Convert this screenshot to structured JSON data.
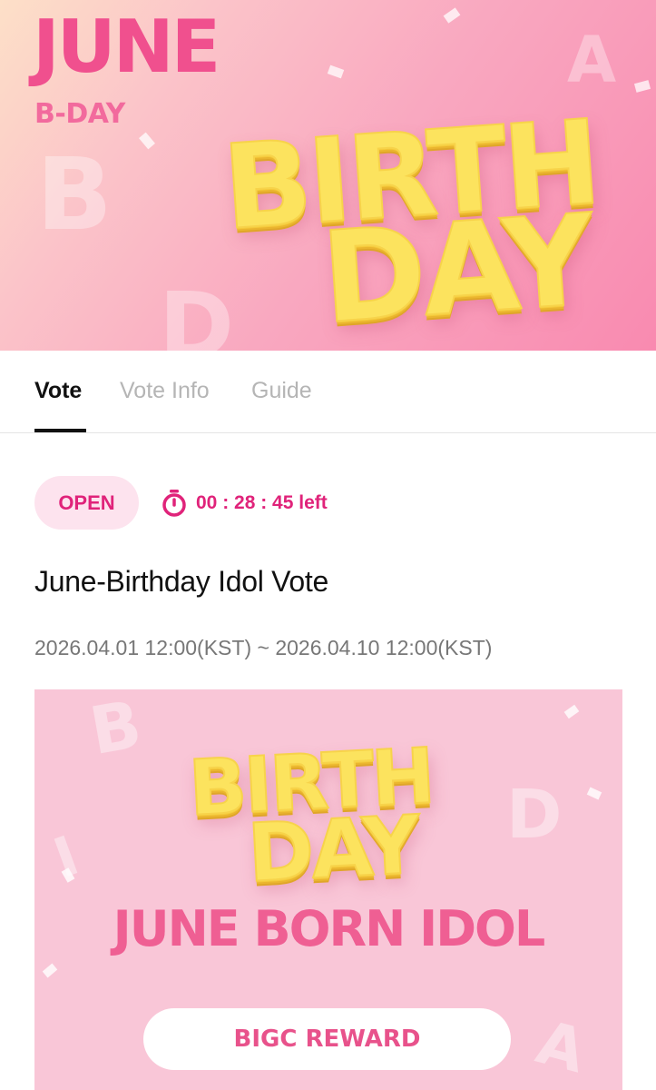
{
  "hero": {
    "month": "JUNE",
    "subtitle": "B-DAY",
    "word_line1": "BIRTH",
    "word_line2": "DAY",
    "ghost_letters": [
      "B",
      "D",
      "A"
    ]
  },
  "tabs": [
    {
      "label": "Vote",
      "active": true
    },
    {
      "label": "Vote Info",
      "active": false
    },
    {
      "label": "Guide",
      "active": false
    }
  ],
  "status": {
    "badge": "OPEN",
    "countdown": "00 : 28 : 45 left",
    "icon": "stopwatch-icon"
  },
  "vote": {
    "title": "June-Birthday Idol Vote",
    "period": "2026.04.01 12:00(KST) ~ 2026.04.10 12:00(KST)"
  },
  "event_banner": {
    "word_line1": "BIRTH",
    "word_line2": "DAY",
    "headline": "JUNE BORN IDOL",
    "button_label": "BIGC REWARD",
    "ghost_letters": [
      "B",
      "D",
      "A",
      "I"
    ]
  },
  "colors": {
    "accent": "#e0237a",
    "balloon_yellow": "#fce35e",
    "headline_pink": "#ef5f93",
    "banner_bg": "#f9c6d7"
  }
}
